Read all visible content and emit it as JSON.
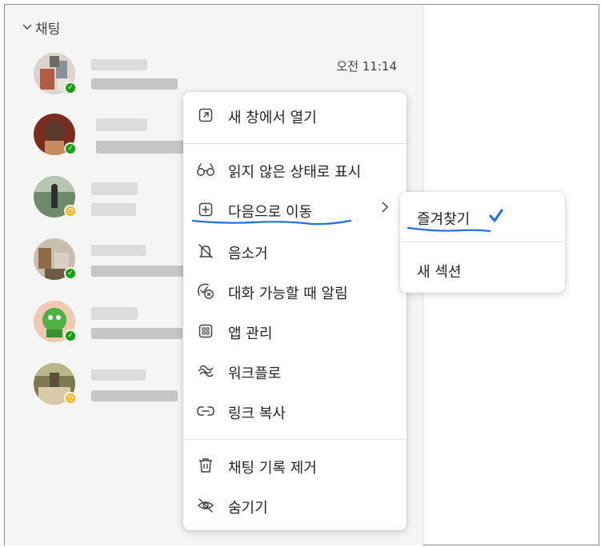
{
  "sidebar": {
    "section_title": "채팅",
    "chats": [
      {
        "time": "오전 11:14",
        "presence": "available"
      },
      {
        "time": "",
        "presence": "available"
      },
      {
        "time": "",
        "presence": "away"
      },
      {
        "time": "",
        "presence": "available"
      },
      {
        "time": "",
        "presence": "available"
      },
      {
        "time": "",
        "presence": "away"
      }
    ]
  },
  "context_menu": {
    "items": [
      {
        "label": "새 창에서 열기",
        "icon": "open-in-new-window-icon"
      },
      {
        "label": "읽지 않은 상태로 표시",
        "icon": "glasses-icon"
      },
      {
        "label": "다음으로 이동",
        "icon": "add-square-icon",
        "has_submenu": true
      },
      {
        "label": "음소거",
        "icon": "bell-off-icon"
      },
      {
        "label": "대화 가능할 때 알림",
        "icon": "presence-notify-icon"
      },
      {
        "label": "앱 관리",
        "icon": "apps-grid-icon"
      },
      {
        "label": "워크플로",
        "icon": "workflow-icon"
      },
      {
        "label": "링크 복사",
        "icon": "link-icon"
      },
      {
        "label": "채팅 기록 제거",
        "icon": "trash-icon"
      },
      {
        "label": "숨기기",
        "icon": "eye-off-icon"
      }
    ]
  },
  "submenu": {
    "items": [
      {
        "label": "즐겨찾기",
        "checked": true
      },
      {
        "label": "새 섹션",
        "checked": false
      }
    ]
  },
  "colors": {
    "sidebar_bg": "#f5f5f5",
    "available": "#13a10e",
    "away": "#f8b623",
    "annotation_blue": "#1f6fe0"
  }
}
